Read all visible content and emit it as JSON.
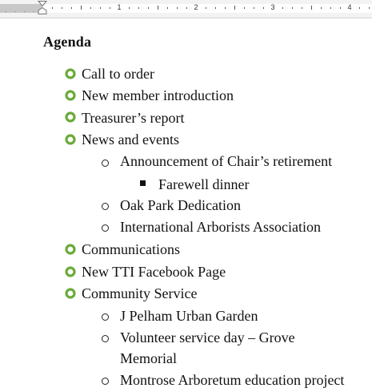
{
  "ruler": {
    "dots": "· · · ·",
    "numbers": [
      "1",
      "2",
      "3",
      "4"
    ]
  },
  "document": {
    "heading": "Agenda",
    "items": [
      {
        "text": "Call to order"
      },
      {
        "text": "New member introduction"
      },
      {
        "text": "Treasurer’s report"
      },
      {
        "text": "News and events"
      },
      {
        "text": "Announcement of Chair’s retirement"
      },
      {
        "text": "Farewell dinner"
      },
      {
        "text": "Oak Park Dedication"
      },
      {
        "text": "International Arborists Association"
      },
      {
        "text": "Communications"
      },
      {
        "text": "New TTI Facebook Page"
      },
      {
        "text": "Community Service"
      },
      {
        "text": "J Pelham Urban Garden"
      },
      {
        "text": "Volunteer service day – Grove"
      },
      {
        "text": "Memorial"
      },
      {
        "text": "Montrose Arboretum education project"
      }
    ]
  },
  "colors": {
    "level1_bullet": "#6aaa3a",
    "ruler_margin": "#c8c8c8"
  },
  "icons": {
    "level1": "green-ring-bullet-icon",
    "level2": "hollow-circle-bullet-icon",
    "level3": "filled-square-bullet-icon"
  }
}
